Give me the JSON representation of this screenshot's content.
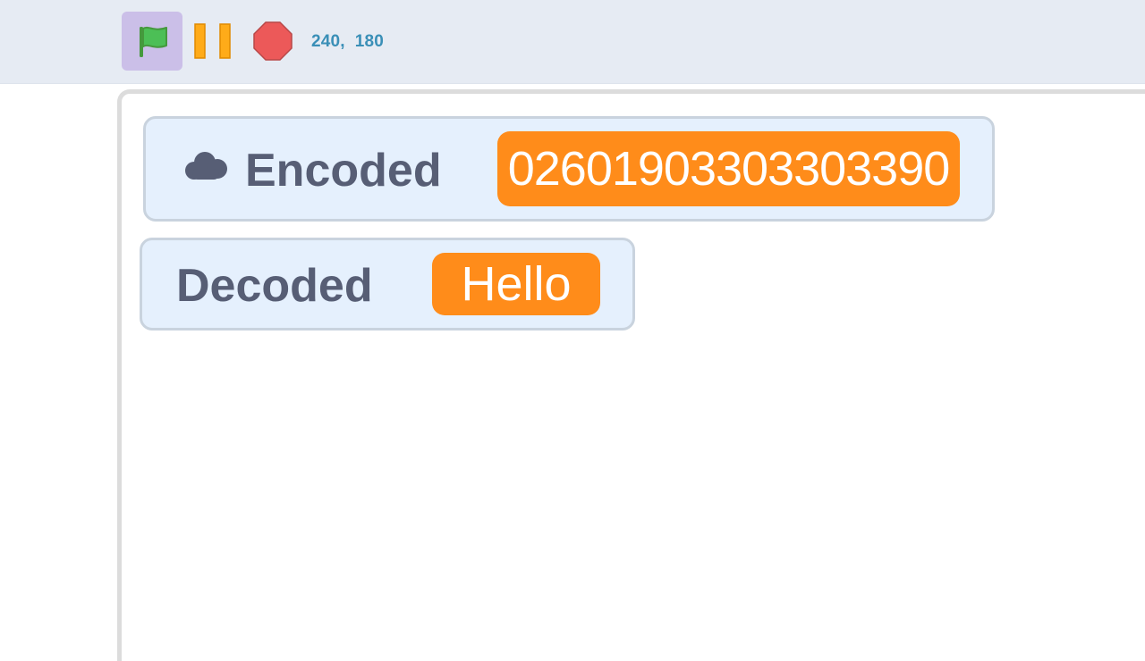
{
  "toolbar": {
    "green_flag_icon": "green-flag-icon",
    "pause_icon": "pause-icon",
    "stop_icon": "stop-sign-icon",
    "coordinates": "240,  180",
    "colors": {
      "flag_active_bg": "#cbbfe8",
      "flag": "#4cbf56",
      "pause": "#ffab19",
      "stop": "#ec5959",
      "coords_text": "#3a8fb7"
    }
  },
  "stage": {
    "monitors": [
      {
        "label": "Encoded",
        "value": "02601903303303390",
        "cloud_variable": true
      },
      {
        "label": "Decoded",
        "value": "Hello",
        "cloud_variable": false
      }
    ],
    "colors": {
      "monitor_bg": "#e5f0fd",
      "monitor_border": "#c9d3de",
      "label_text": "#575e75",
      "value_bg": "#ff8c1a",
      "value_text": "#ffffff"
    }
  }
}
